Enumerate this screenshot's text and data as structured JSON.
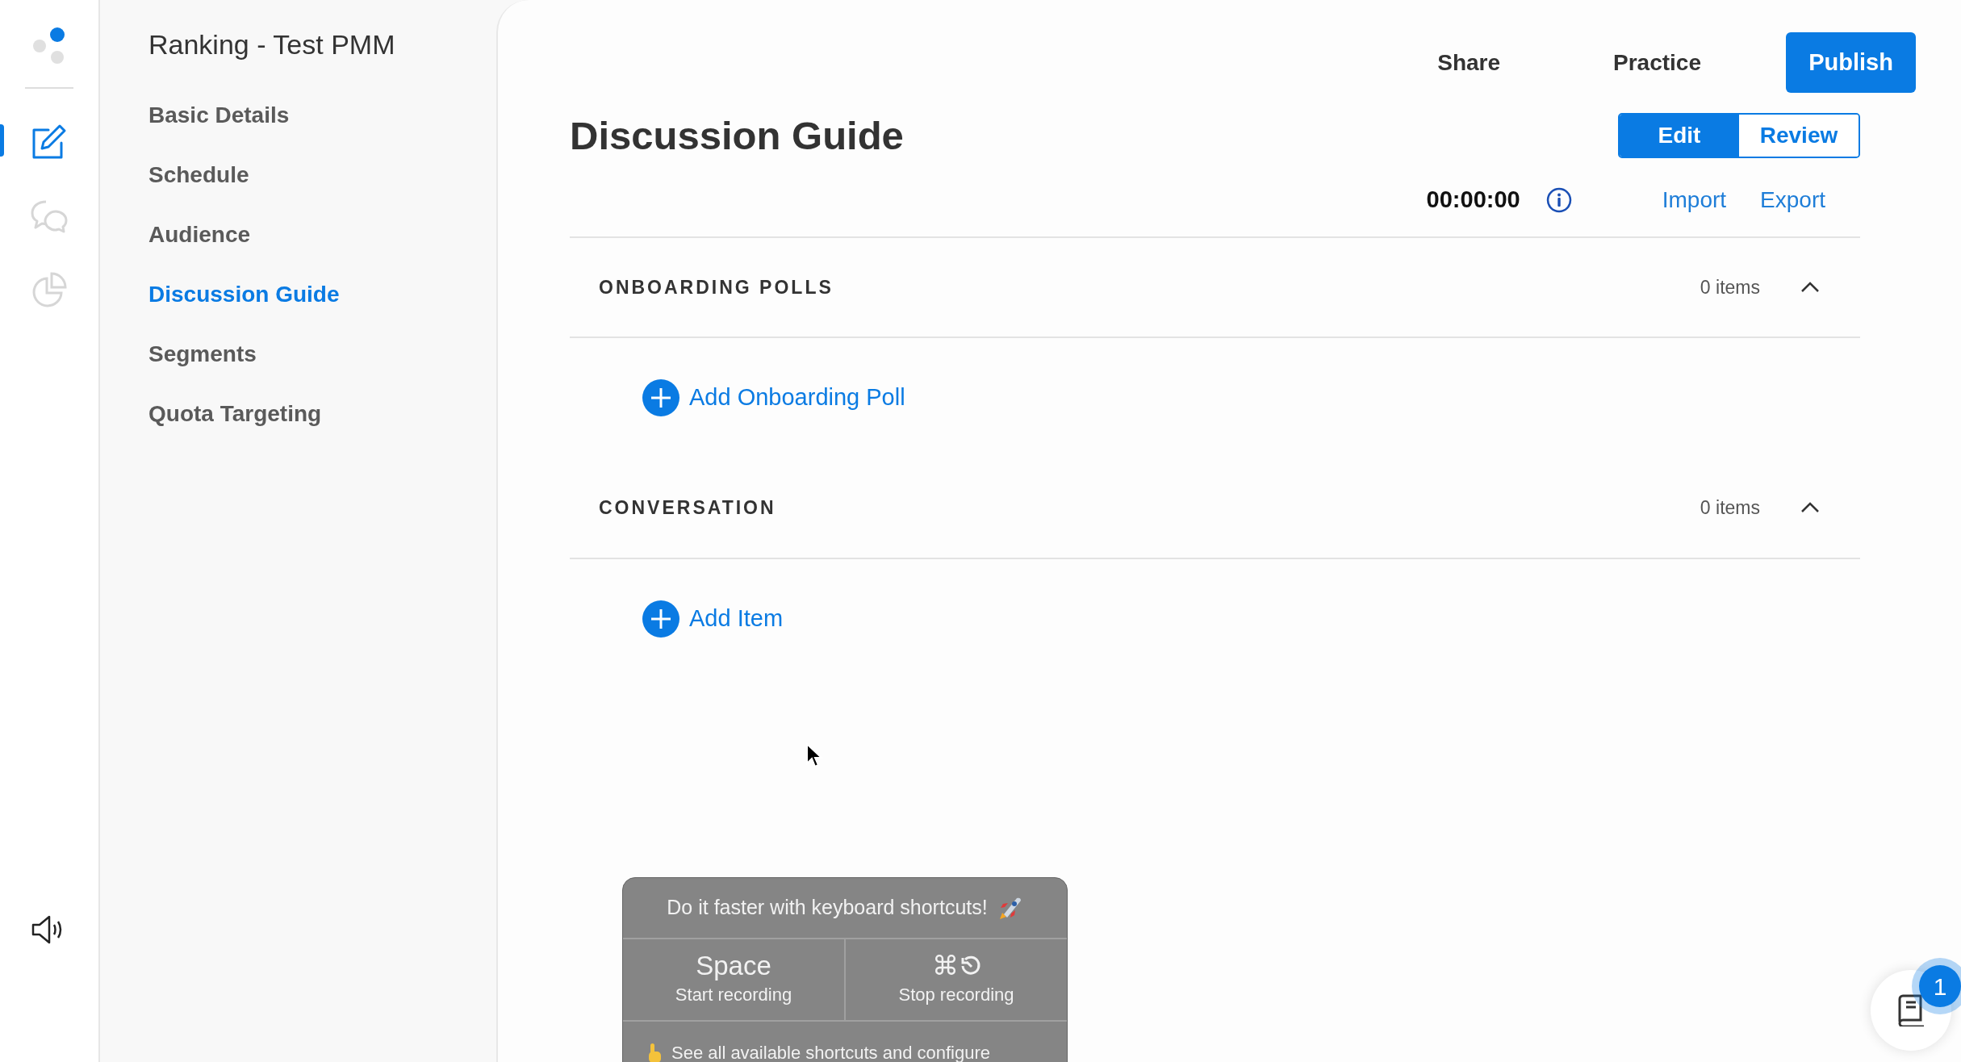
{
  "rail": {
    "items": [
      {
        "kind": "edit",
        "selected": true
      },
      {
        "kind": "chat",
        "selected": false
      },
      {
        "kind": "chart",
        "selected": false
      }
    ]
  },
  "sidebar": {
    "title": "Ranking - Test PMM",
    "items": [
      {
        "label": "Basic Details",
        "selected": false
      },
      {
        "label": "Schedule",
        "selected": false
      },
      {
        "label": "Audience",
        "selected": false
      },
      {
        "label": "Discussion Guide",
        "selected": true
      },
      {
        "label": "Segments",
        "selected": false
      },
      {
        "label": "Quota Targeting",
        "selected": false
      }
    ]
  },
  "header": {
    "actions": [
      "Share",
      "Practice"
    ],
    "publish": "Publish",
    "title": "Discussion Guide",
    "modes": [
      {
        "label": "Edit",
        "selected": true
      },
      {
        "label": "Review",
        "selected": false
      }
    ],
    "timer": "00:00:00",
    "links": [
      "Import",
      "Export"
    ]
  },
  "sections": [
    {
      "title": "ONBOARDING POLLS",
      "count": "0 items",
      "expanded": true,
      "add_label": "Add Onboarding Poll"
    },
    {
      "title": "CONVERSATION",
      "count": "0 items",
      "expanded": true,
      "add_label": "Add Item"
    }
  ],
  "shortcuts_popup": {
    "title": "Do it faster with keyboard shortcuts!",
    "shortcuts": [
      {
        "kind": "text",
        "key": "Space",
        "action": "Start recording"
      },
      {
        "kind": "key_icon",
        "key": "⌘",
        "action": "Stop recording"
      }
    ],
    "footer": "See all available shortcuts and configure"
  },
  "help": {
    "badge": "1"
  }
}
